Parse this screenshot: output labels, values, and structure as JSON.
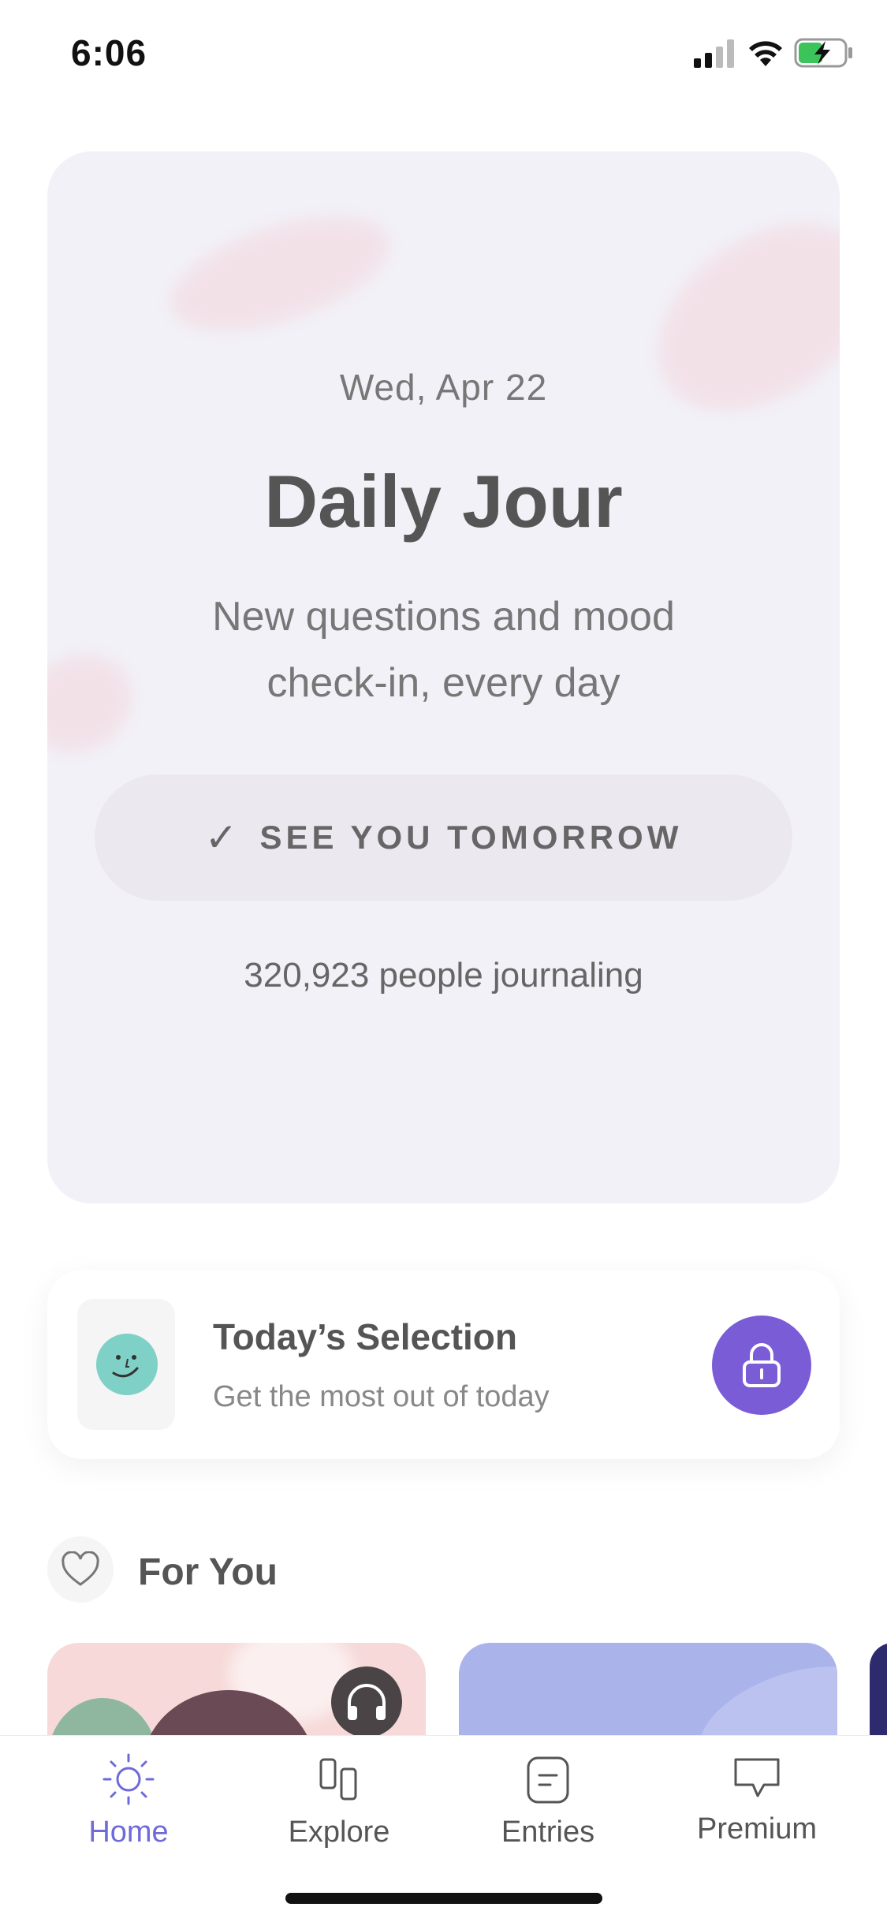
{
  "status_bar": {
    "time": "6:06"
  },
  "daily_card": {
    "date": "Wed, Apr 22",
    "title": "Daily Jour",
    "subtitle": "New questions and mood check-in, every day",
    "cta_check": "✓",
    "cta_label": "SEE YOU TOMORROW",
    "people_count": "320,923 people journaling"
  },
  "selection": {
    "title": "Today’s Selection",
    "subtitle": "Get the most out of today",
    "icon": "lock-icon"
  },
  "for_you": {
    "title": "For You",
    "icon": "heart-icon"
  },
  "tabbar": {
    "accent": "#6e6ad8",
    "items": [
      {
        "label": "Home",
        "icon": "sun-icon",
        "active": true
      },
      {
        "label": "Explore",
        "icon": "explore-icon",
        "active": false
      },
      {
        "label": "Entries",
        "icon": "entries-icon",
        "active": false
      },
      {
        "label": "Premium",
        "icon": "chat-bubble-icon",
        "active": false
      }
    ]
  }
}
